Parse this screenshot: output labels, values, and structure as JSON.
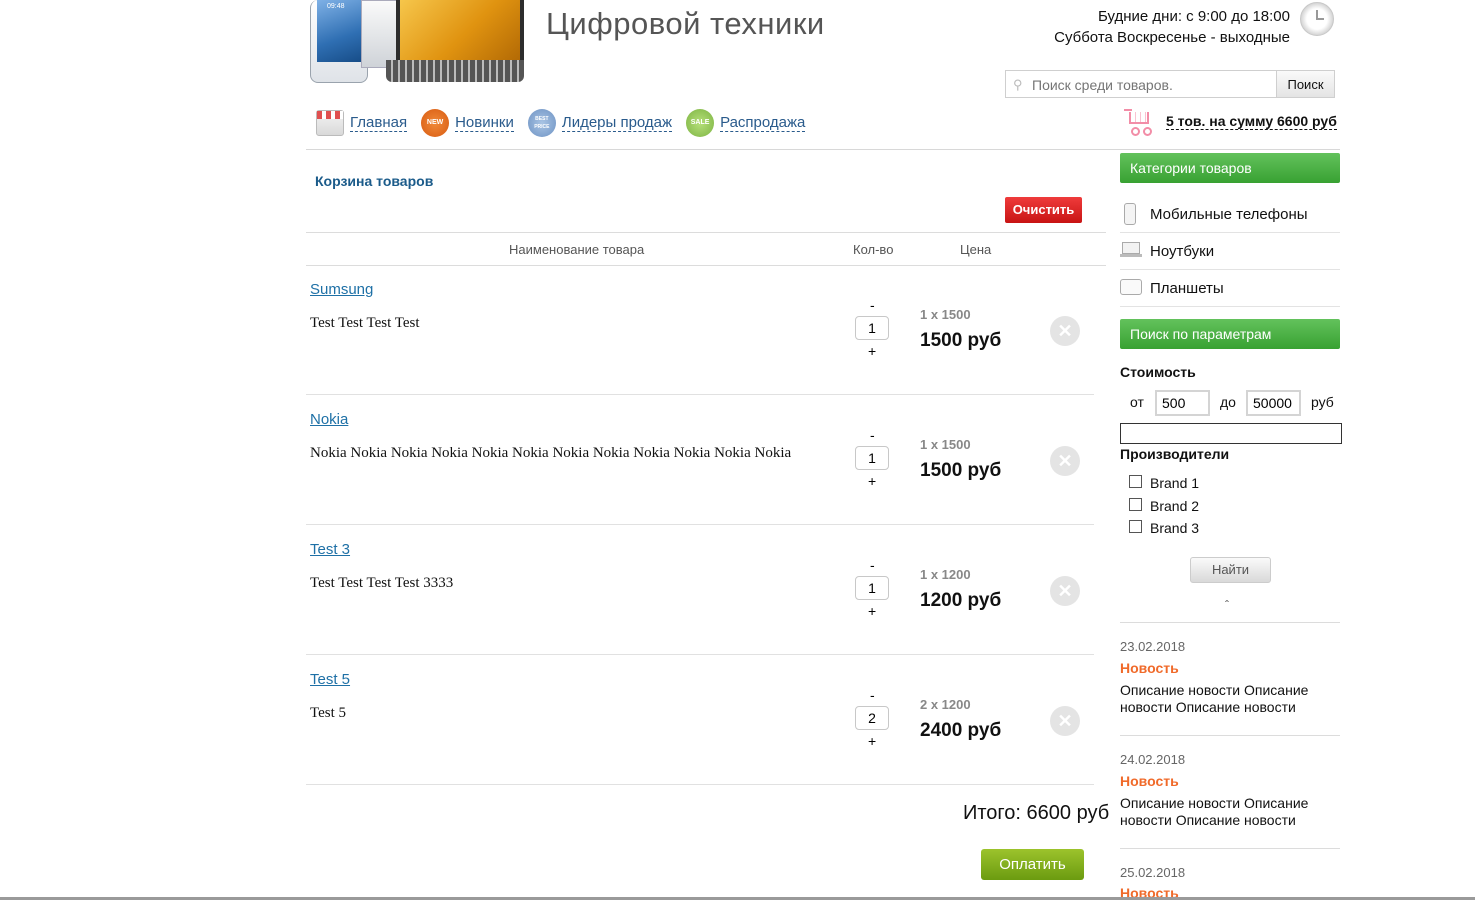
{
  "header": {
    "title": "Цифровой техники",
    "hours_line1": "Будние дни: с 9:00 до 18:00",
    "hours_line2": "Суббота Воскресенье - выходные",
    "search_placeholder": "Поиск среди товаров.",
    "search_button": "Поиск",
    "phone_time": "09:48"
  },
  "nav": {
    "items": [
      {
        "label": "Главная",
        "icon": "shop-icon"
      },
      {
        "label": "Новинки",
        "icon": "new-badge-icon",
        "badge": "NEW"
      },
      {
        "label": "Лидеры продаж",
        "icon": "best-price-badge-icon",
        "badge": "BEST PRICE"
      },
      {
        "label": "Распродажа",
        "icon": "sale-badge-icon",
        "badge": "SALE"
      }
    ],
    "cart_summary": "5 тов. на сумму 6600 руб"
  },
  "cart": {
    "title": "Корзина товаров",
    "clear_button": "Очистить",
    "columns": {
      "name": "Наименование товара",
      "qty": "Кол-во",
      "price": "Цена"
    },
    "items": [
      {
        "name": "Sumsung",
        "desc": "Test Test Test Test",
        "minus": "-",
        "qty": "1",
        "plus": "+",
        "unit": "1 x 1500",
        "sum": "1500 руб"
      },
      {
        "name": "Nokia",
        "desc": "Nokia Nokia Nokia Nokia Nokia Nokia Nokia Nokia Nokia Nokia Nokia Nokia",
        "minus": "-",
        "qty": "1",
        "plus": "+",
        "unit": "1 x 1500",
        "sum": "1500 руб"
      },
      {
        "name": "Test 3",
        "desc": "Test Test Test Test 3333",
        "minus": "-",
        "qty": "1",
        "plus": "+",
        "unit": "1 x 1200",
        "sum": "1200 руб"
      },
      {
        "name": "Test 5",
        "desc": "Test 5",
        "minus": "-",
        "qty": "2",
        "plus": "+",
        "unit": "2 x 1200",
        "sum": "2400 руб"
      }
    ],
    "total": "Итого: 6600 руб",
    "pay_button": "Оплатить"
  },
  "sidebar": {
    "categories_title": "Категории товаров",
    "categories": [
      {
        "label": "Мобильные телефоны",
        "icon": "phone-icon"
      },
      {
        "label": "Ноутбуки",
        "icon": "laptop-icon"
      },
      {
        "label": "Планшеты",
        "icon": "tablet-icon"
      }
    ],
    "params_title": "Поиск по параметрам",
    "price_label": "Стоимость",
    "from_label": "от",
    "from_value": "500",
    "to_label": "до",
    "to_value": "50000",
    "currency": "руб",
    "brands_label": "Производители",
    "brands": [
      "Brand 1",
      "Brand 2",
      "Brand 3"
    ],
    "find_button": "Найти",
    "collapse_caret": "ˆ",
    "news": [
      {
        "date": "23.02.2018",
        "title": "Новость",
        "text": "Описание новости Описание новости Описание новости"
      },
      {
        "date": "24.02.2018",
        "title": "Новость",
        "text": "Описание новости Описание новости Описание новости"
      },
      {
        "date": "25.02.2018",
        "title": "Новость",
        "text": ""
      }
    ]
  },
  "colors": {
    "link": "#1e70a6",
    "nav_link": "#2a5b8c",
    "clear_button": "#d81e1e",
    "pay_button": "#7fab1a",
    "sidebar_header": "#4cb045",
    "news_title": "#f06a2a"
  }
}
